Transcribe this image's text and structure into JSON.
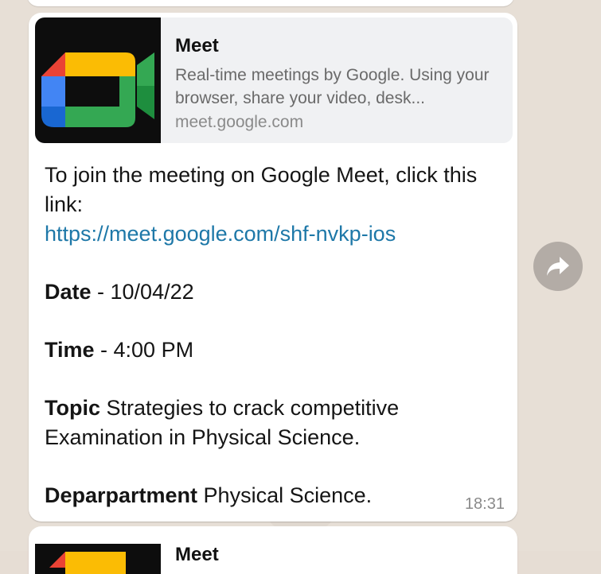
{
  "preview": {
    "title": "Meet",
    "description": "Real-time meetings by Google. Using your browser, share your video, desk...",
    "domain": "meet.google.com",
    "thumbnail_icon": "google-meet-logo"
  },
  "message": {
    "intro": "To join the meeting on Google Meet, click this link:",
    "link": "https://meet.google.com/shf-nvkp-ios",
    "date_label": "Date",
    "date_value": " - 10/04/22",
    "time_label": "Time",
    "time_value": " - 4:00 PM",
    "topic_label": "Topic",
    "topic_value": " Strategies to crack competitive Examination in Physical Science.",
    "department_label": "Deparpartment",
    "department_value": " Physical Science.",
    "timestamp": "18:31"
  },
  "forward_button": {
    "icon": "forward-arrow-icon"
  },
  "next_message": {
    "preview_title": "Meet"
  },
  "colors": {
    "link": "#1e78a8",
    "bubble": "#ffffff",
    "chat_background": "#e7dfd6",
    "preview_background": "#f0f1f3"
  }
}
